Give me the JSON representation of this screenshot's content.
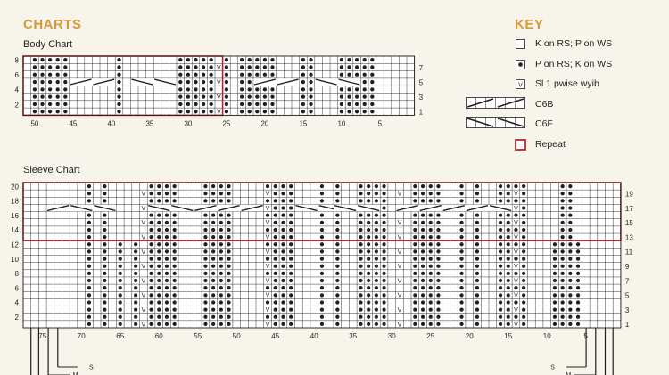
{
  "headings": {
    "charts": "CHARTS",
    "key": "KEY"
  },
  "body_chart": {
    "title": "Body Chart",
    "left_row_labels": [
      "8",
      "6",
      "4",
      "2"
    ],
    "right_row_labels": [
      "7",
      "5",
      "3",
      "1"
    ],
    "column_labels": [
      "50",
      "45",
      "40",
      "35",
      "30",
      "25",
      "20",
      "15",
      "10",
      "5"
    ]
  },
  "sleeve_chart": {
    "title": "Sleeve Chart",
    "left_row_labels": [
      "20",
      "18",
      "16",
      "14",
      "12",
      "10",
      "8",
      "6",
      "4",
      "2"
    ],
    "right_row_labels": [
      "19",
      "17",
      "15",
      "13",
      "11",
      "9",
      "7",
      "5",
      "3",
      "1"
    ],
    "column_labels": [
      "75",
      "70",
      "65",
      "60",
      "55",
      "50",
      "45",
      "40",
      "35",
      "30",
      "25",
      "20",
      "15",
      "10",
      "5"
    ],
    "guide_labels": {
      "s": "S",
      "m": "M"
    }
  },
  "key": {
    "items": [
      {
        "symbol": "empty-square",
        "label": "K on RS; P on WS"
      },
      {
        "symbol": "dot-square",
        "label": "P on RS; K on WS"
      },
      {
        "symbol": "v-square",
        "label": "Sl 1 pwise wyib"
      },
      {
        "symbol": "c6b-cable",
        "label": "C6B"
      },
      {
        "symbol": "c6f-cable",
        "label": "C6F"
      },
      {
        "symbol": "red-square",
        "label": "Repeat"
      }
    ],
    "v_glyph": "V"
  },
  "colors": {
    "heading": "#d79a3a",
    "repeat": "#b3282d",
    "grid": "#231f20",
    "background": "#f7f4ec"
  }
}
